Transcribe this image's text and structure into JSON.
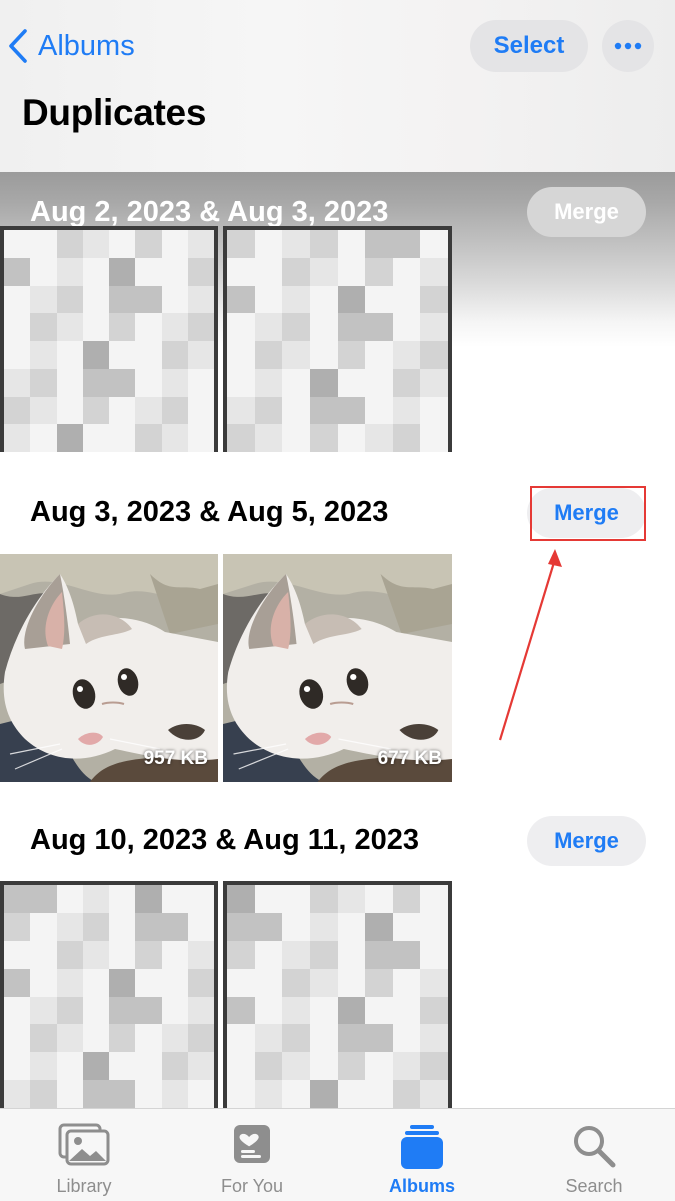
{
  "header": {
    "back_label": "Albums",
    "select_label": "Select",
    "title": "Duplicates"
  },
  "groups": [
    {
      "date": "Aug 2, 2023 & Aug 3, 2023",
      "merge_label": "Merge",
      "photos": [
        {
          "kind": "pixelated",
          "size": ""
        },
        {
          "kind": "pixelated",
          "size": ""
        }
      ]
    },
    {
      "date": "Aug 3, 2023 & Aug 5, 2023",
      "merge_label": "Merge",
      "highlighted": true,
      "photos": [
        {
          "kind": "cat",
          "size": "957 KB"
        },
        {
          "kind": "cat",
          "size": "677 KB"
        }
      ]
    },
    {
      "date": "Aug 10, 2023 & Aug 11, 2023",
      "merge_label": "Merge",
      "photos": [
        {
          "kind": "pixelated",
          "size": ""
        },
        {
          "kind": "pixelated",
          "size": ""
        }
      ]
    }
  ],
  "tabbar": {
    "tabs": [
      {
        "label": "Library",
        "icon": "library-icon",
        "active": false
      },
      {
        "label": "For You",
        "icon": "for-you-icon",
        "active": false
      },
      {
        "label": "Albums",
        "icon": "albums-icon",
        "active": true
      },
      {
        "label": "Search",
        "icon": "search-icon",
        "active": false
      }
    ]
  },
  "colors": {
    "accent": "#1f7cf5",
    "annotation": "#e53935",
    "inactive_tab": "#8e8e8e"
  }
}
